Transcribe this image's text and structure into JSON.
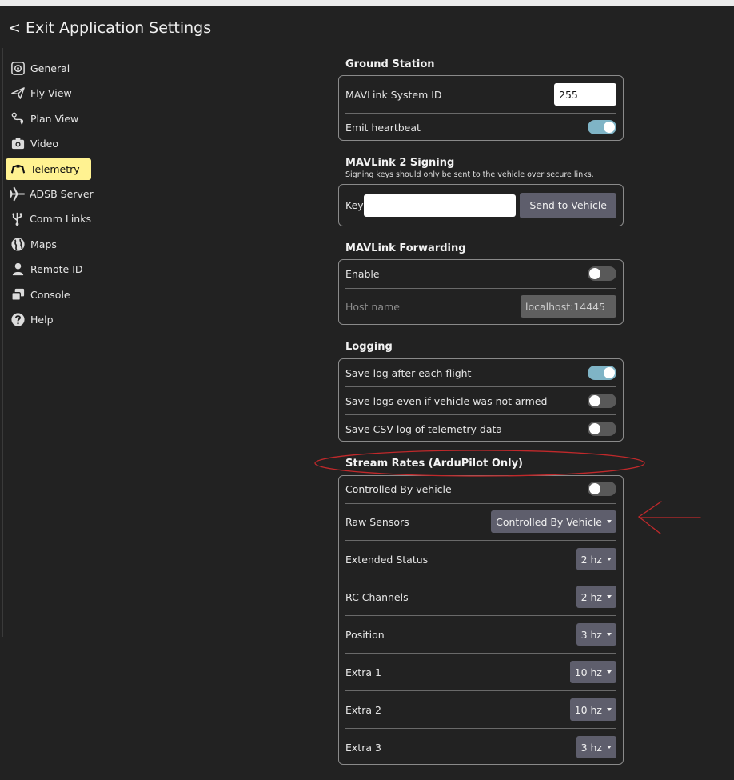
{
  "header": {
    "exit_label": "< Exit Application Settings"
  },
  "sidebar": {
    "items": [
      {
        "label": "General",
        "icon": "general-icon"
      },
      {
        "label": "Fly View",
        "icon": "fly-view-icon"
      },
      {
        "label": "Plan View",
        "icon": "plan-view-icon"
      },
      {
        "label": "Video",
        "icon": "camera-icon"
      },
      {
        "label": "Telemetry",
        "icon": "telemetry-icon",
        "active": true
      },
      {
        "label": "ADSB Server",
        "icon": "airplane-icon"
      },
      {
        "label": "Comm Links",
        "icon": "usb-icon"
      },
      {
        "label": "Maps",
        "icon": "globe-icon"
      },
      {
        "label": "Remote ID",
        "icon": "person-icon"
      },
      {
        "label": "Console",
        "icon": "console-icon"
      },
      {
        "label": "Help",
        "icon": "help-icon"
      }
    ]
  },
  "ground_station": {
    "title": "Ground Station",
    "system_id_label": "MAVLink System ID",
    "system_id_value": "255",
    "heartbeat_label": "Emit heartbeat",
    "heartbeat_on": true
  },
  "signing": {
    "title": "MAVLink 2 Signing",
    "subtitle": "Signing keys should only be sent to the vehicle over secure links.",
    "key_label": "Key",
    "key_value": "",
    "send_button": "Send to Vehicle"
  },
  "forwarding": {
    "title": "MAVLink Forwarding",
    "enable_label": "Enable",
    "enable_on": false,
    "host_label": "Host name",
    "host_value": "localhost:14445"
  },
  "logging": {
    "title": "Logging",
    "save_after_flight_label": "Save log after each flight",
    "save_after_flight_on": true,
    "save_not_armed_label": "Save logs even if vehicle was not armed",
    "save_not_armed_on": false,
    "save_csv_label": "Save CSV log of telemetry data",
    "save_csv_on": false
  },
  "stream_rates": {
    "title": "Stream Rates (ArduPilot Only)",
    "controlled_label": "Controlled By vehicle",
    "controlled_on": false,
    "rows": [
      {
        "label": "Raw Sensors",
        "value": "Controlled By Vehicle"
      },
      {
        "label": "Extended Status",
        "value": "2 hz"
      },
      {
        "label": "RC Channels",
        "value": "2 hz"
      },
      {
        "label": "Position",
        "value": "3 hz"
      },
      {
        "label": "Extra 1",
        "value": "10 hz"
      },
      {
        "label": "Extra 2",
        "value": "10 hz"
      },
      {
        "label": "Extra 3",
        "value": "3 hz"
      }
    ]
  },
  "colors": {
    "accent": "#fff291",
    "toggle_on": "#7fb4c6",
    "annotation": "#c0292b"
  }
}
